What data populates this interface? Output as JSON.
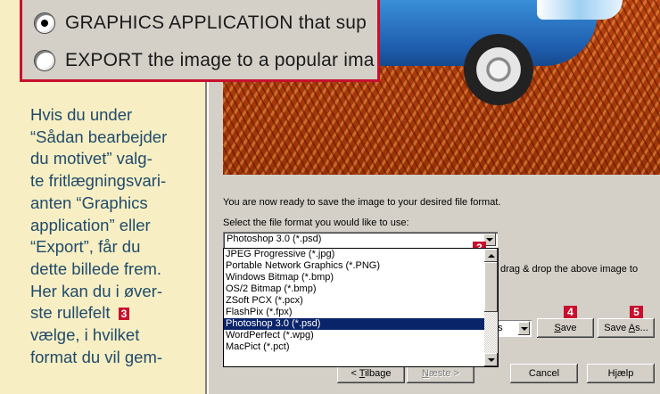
{
  "radio_options": [
    {
      "label": "GRAPHICS APPLICATION that sup",
      "checked": true
    },
    {
      "label": "EXPORT the image to a popular ima",
      "checked": false
    }
  ],
  "article": {
    "text": "Hvis du under\n“Sådan bearbejder\ndu motivet” valg-\nte fritlægningsvari-\nanten “Graphics\napplication” eller\n“Export”, får du\ndette billede frem.\nHer kan du i øver-\nste rullefelt",
    "ref_badge": "3",
    "text_after": "\nvælge, i hvilket\nformat du vil gem-"
  },
  "dialog": {
    "ready_text": "You are now ready to save the image to your desired file format.",
    "select_label": "Select the file format you would like to use:",
    "format_value": "Photoshop 3.0 (*.psd)",
    "format_options": [
      "JPEG Progressive (*.jpg)",
      "Portable Network Graphics (*.PNG)",
      "Windows Bitmap (*.bmp)",
      "OS/2 Bitmap (*.bmp)",
      "ZSoft PCX (*.pcx)",
      "FlashPix (*.fpx)",
      "Photoshop 3.0 (*.psd)",
      "WordPerfect (*.wpg)",
      "MacPict (*.pct)"
    ],
    "selected_index": 6,
    "drag_text": "drag & drop the above image to",
    "small_select_value": "ps",
    "save_mnemonic": "S",
    "save_rest": "ave",
    "saveas_prefix": "Save ",
    "saveas_mnemonic": "A",
    "saveas_rest": "s...",
    "back_prefix": "< ",
    "back_mnemonic": "T",
    "back_rest": "ilbage",
    "next_mnemonic": "N",
    "next_rest": "æste >",
    "cancel_label": "Cancel",
    "help_label": "Hjælp"
  },
  "badges": {
    "format": "3",
    "save": "4",
    "save_as": "5"
  },
  "colors": {
    "accent_red": "#c8102e",
    "selection_blue": "#0a246a",
    "article_text": "#214a6c"
  }
}
